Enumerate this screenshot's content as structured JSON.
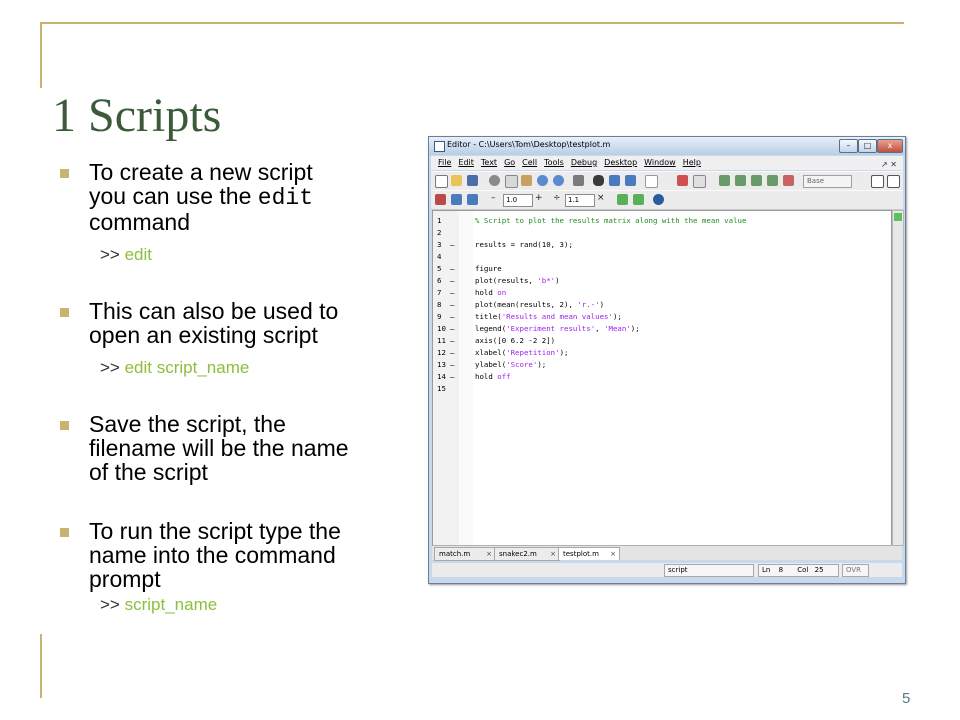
{
  "slide": {
    "title": "1 Scripts",
    "page_number": "5"
  },
  "bullets": [
    {
      "lines": [
        "To create a new script",
        "you can use the ",
        "edit",
        "command"
      ],
      "sub_prompt": ">> ",
      "sub_cmd": "edit"
    },
    {
      "lines": [
        "This can also be used to",
        "open an existing script"
      ],
      "sub_prompt": ">> ",
      "sub_cmd": "edit script_name"
    },
    {
      "lines": [
        "Save the script, the",
        "filename will be the name",
        "of the script"
      ]
    },
    {
      "lines": [
        "To run the script type the",
        "name into the command",
        "prompt"
      ],
      "sub_prompt": ">> ",
      "sub_cmd": "script_name"
    }
  ],
  "editor": {
    "window_title": "Editor - C:\\Users\\Tom\\Desktop\\testplot.m",
    "window_buttons": [
      "–",
      "□",
      "x"
    ],
    "menus": [
      "File",
      "Edit",
      "Text",
      "Go",
      "Cell",
      "Tools",
      "Debug",
      "Desktop",
      "Window",
      "Help"
    ],
    "menu_right": "↗ ✕",
    "toolbar": {
      "style_dropdown": "Base",
      "step_minus": "–",
      "step_value": "1.0",
      "step_plus": "+",
      "step_div": "÷",
      "step_value2": "1.1",
      "step_mul": "×"
    },
    "code_lines": [
      {
        "num": "1",
        "bp": "",
        "segments": [
          {
            "t": "% Script to plot the results matrix along with the mean value",
            "c": "comment"
          }
        ]
      },
      {
        "num": "2",
        "bp": "",
        "segments": []
      },
      {
        "num": "3",
        "bp": "–",
        "segments": [
          {
            "t": "results = rand(10, 3);",
            "c": "plain"
          }
        ]
      },
      {
        "num": "4",
        "bp": "",
        "segments": []
      },
      {
        "num": "5",
        "bp": "–",
        "segments": [
          {
            "t": "figure",
            "c": "plain"
          }
        ]
      },
      {
        "num": "6",
        "bp": "–",
        "segments": [
          {
            "t": "plot(results, ",
            "c": "plain"
          },
          {
            "t": "'b*'",
            "c": "str"
          },
          {
            "t": ")",
            "c": "plain"
          }
        ]
      },
      {
        "num": "7",
        "bp": "–",
        "segments": [
          {
            "t": "hold ",
            "c": "plain"
          },
          {
            "t": "on",
            "c": "str"
          }
        ]
      },
      {
        "num": "8",
        "bp": "–",
        "segments": [
          {
            "t": "plot(mean(results, 2), ",
            "c": "plain"
          },
          {
            "t": "'r.-'",
            "c": "str"
          },
          {
            "t": ")",
            "c": "plain"
          }
        ]
      },
      {
        "num": "9",
        "bp": "–",
        "segments": [
          {
            "t": "title(",
            "c": "plain"
          },
          {
            "t": "'Results and mean values'",
            "c": "str"
          },
          {
            "t": ");",
            "c": "plain"
          }
        ]
      },
      {
        "num": "10",
        "bp": "–",
        "segments": [
          {
            "t": "legend(",
            "c": "plain"
          },
          {
            "t": "'Experiment results'",
            "c": "str"
          },
          {
            "t": ", ",
            "c": "plain"
          },
          {
            "t": "'Mean'",
            "c": "str"
          },
          {
            "t": ");",
            "c": "plain"
          }
        ]
      },
      {
        "num": "11",
        "bp": "–",
        "segments": [
          {
            "t": "axis([0 6.2 -2 2])",
            "c": "plain"
          }
        ]
      },
      {
        "num": "12",
        "bp": "–",
        "segments": [
          {
            "t": "xlabel(",
            "c": "plain"
          },
          {
            "t": "'Repetition'",
            "c": "str"
          },
          {
            "t": ");",
            "c": "plain"
          }
        ]
      },
      {
        "num": "13",
        "bp": "–",
        "segments": [
          {
            "t": "ylabel(",
            "c": "plain"
          },
          {
            "t": "'Score'",
            "c": "str"
          },
          {
            "t": ");",
            "c": "plain"
          }
        ]
      },
      {
        "num": "14",
        "bp": "–",
        "segments": [
          {
            "t": "hold ",
            "c": "plain"
          },
          {
            "t": "off",
            "c": "str"
          }
        ]
      },
      {
        "num": "15",
        "bp": "",
        "segments": []
      }
    ],
    "tabs": [
      {
        "label": "match.m",
        "active": false
      },
      {
        "label": "snakec2.m",
        "active": false
      },
      {
        "label": "testplot.m",
        "active": true
      }
    ],
    "tab_close": "×",
    "status": {
      "context": "script",
      "ln_label": "Ln",
      "ln_value": "8",
      "col_label": "Col",
      "col_value": "25",
      "ovr": "OVR"
    }
  },
  "colors": {
    "accent": "#c8b46e",
    "title": "#3a5a3a",
    "command": "#8cbf3a",
    "comment": "#228b22",
    "string": "#a020f0"
  },
  "icons": [
    "app-icon",
    "new-file-icon",
    "open-folder-icon",
    "save-icon",
    "cut-icon",
    "copy-icon",
    "paste-icon",
    "undo-icon",
    "redo-icon",
    "print-icon",
    "find-icon",
    "back-icon",
    "forward-icon",
    "function-icon",
    "stack-icon",
    "cell-icon",
    "help-icon",
    "split-icon"
  ]
}
